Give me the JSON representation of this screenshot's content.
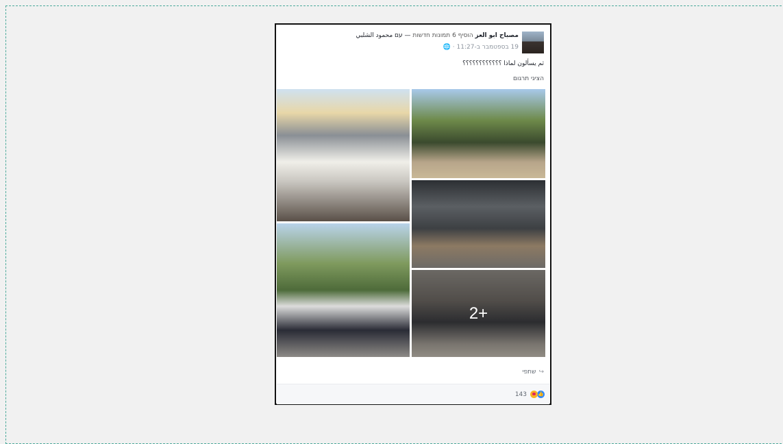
{
  "post": {
    "author": "مصباح ابو العز",
    "action_text": "הוסיף 6 תמונות חדשות",
    "with_text": "— עם محمود الشلبي",
    "timestamp": "19 בספטמבר ב-11:27",
    "privacy_icon": "globe-icon",
    "text": "ثم يسألون لماذا ؟؟؟؟؟؟؟؟؟؟؟؟",
    "translate_label": "הציגי תרגום",
    "more_photos_label": "2+",
    "share_label": "שתפי",
    "reaction_count": "143",
    "reaction_icons": [
      "like-icon",
      "love-icon"
    ]
  },
  "colors": {
    "frame_dash": "#4aa99a",
    "like_blue": "#2d88ff"
  }
}
